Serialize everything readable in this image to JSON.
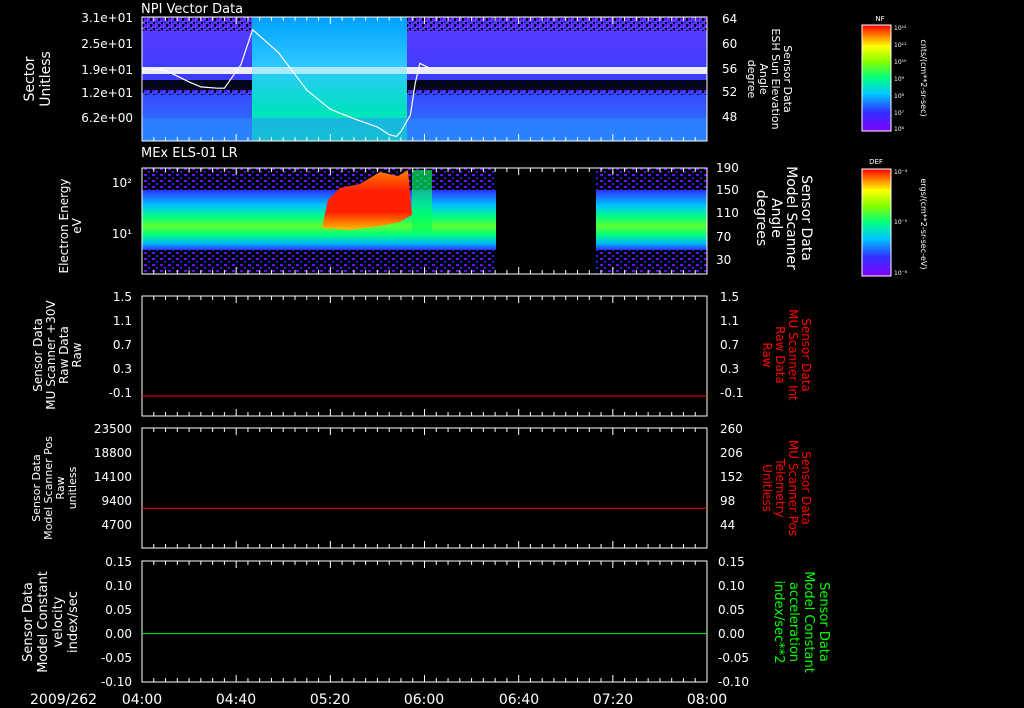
{
  "time_axis": {
    "date": "2009/262",
    "ticks": [
      "04:00",
      "04:40",
      "05:20",
      "06:00",
      "06:40",
      "07:20",
      "08:00"
    ]
  },
  "colorbars": [
    {
      "label": "NF",
      "units": "cnts/(cm**2-sr-sec)",
      "tick_labels": [
        "10¹²",
        "10¹¹",
        "10¹⁰",
        "10⁹",
        "10⁸",
        "10⁷",
        "10⁶"
      ]
    },
    {
      "label": "DEF",
      "units": "ergs/(cm**2-sr-sec-eV)",
      "tick_labels": [
        "10⁻⁴",
        "10⁻⁵",
        "10⁻⁶"
      ]
    }
  ],
  "chart_data": [
    {
      "type": "heatmap",
      "title": "NPI Vector Data",
      "ylabel": [
        "Sector",
        "Unitless"
      ],
      "y_ticks": [
        "3.1e+01",
        "2.5e+01",
        "1.9e+01",
        "1.2e+01",
        "6.2e+00"
      ],
      "right_label": [
        "Sensor Data",
        "ESH Sun Elevation",
        "Angle",
        "degree"
      ],
      "right_ticks": [
        64,
        60,
        56,
        52,
        48
      ],
      "right_range": [
        44.5,
        64
      ],
      "line_series": {
        "name": "ESH Sun Elevation Angle",
        "x": [
          "04:00",
          "04:10",
          "04:20",
          "04:25",
          "04:32",
          "04:35",
          "04:42",
          "04:47",
          "04:58",
          "05:10",
          "05:20",
          "05:30",
          "05:40",
          "05:45",
          "05:48",
          "05:50",
          "05:54",
          "05:56",
          "05:58",
          "06:02"
        ],
        "y": [
          55.8,
          55.6,
          53.8,
          53.0,
          52.8,
          52.8,
          56.5,
          62.0,
          58.4,
          52.5,
          49.5,
          48.0,
          46.7,
          45.5,
          45.2,
          46.0,
          48.6,
          53.5,
          56.7,
          56.0
        ]
      }
    },
    {
      "type": "heatmap",
      "title": "MEx ELS-01 LR",
      "ylabel": [
        "Electron Energy",
        "eV"
      ],
      "y_ticks": [
        "10²",
        "10¹"
      ],
      "right_label": [
        "Sensor Data",
        "Model Scanner",
        "Angle",
        "degrees"
      ],
      "right_ticks": [
        190,
        150,
        110,
        70,
        30
      ],
      "data_gaps": [
        [
          "06:37",
          "07:20"
        ]
      ]
    },
    {
      "type": "line",
      "ylabel": [
        "Sensor Data",
        "MU Scanner +30V",
        "Raw Data",
        "Raw"
      ],
      "y_ticks": [
        "1.5",
        "1.1",
        "0.7",
        "0.3",
        "-0.1"
      ],
      "ylim": [
        -0.3,
        1.5
      ],
      "right_label": [
        "Sensor Data",
        "MU Scanner Int",
        "Raw Data",
        "Raw"
      ],
      "right_ticks": [
        "1.5",
        "1.1",
        "0.7",
        "0.3",
        "-0.1"
      ],
      "series": [
        {
          "x": [
            "04:00",
            "08:00"
          ],
          "values": [
            0.0,
            0.0
          ],
          "color": "#ff0000"
        }
      ]
    },
    {
      "type": "line",
      "ylabel": [
        "Sensor Data",
        "Model Scanner Pos",
        "Raw",
        "unitless"
      ],
      "y_ticks": [
        "23500",
        "18800",
        "14100",
        "9400",
        "4700"
      ],
      "ylim": [
        0,
        23500
      ],
      "right_label": [
        "Sensor Data",
        "MU Scanner Pos",
        "Telemetry",
        "Unitless"
      ],
      "right_ticks": [
        "260",
        "206",
        "152",
        "98",
        "44"
      ],
      "series": [
        {
          "x": [
            "04:00",
            "08:00"
          ],
          "values": [
            7800,
            7800
          ],
          "color": "#ff0000"
        }
      ]
    },
    {
      "type": "line",
      "ylabel": [
        "Sensor Data",
        "Model Constant",
        "velocity",
        "index/sec"
      ],
      "y_ticks": [
        "0.15",
        "0.10",
        "0.05",
        "0.00",
        "-0.05",
        "-0.10"
      ],
      "ylim": [
        -0.1,
        0.15
      ],
      "right_label": [
        "Sensor Data",
        "Model Constant",
        "acceleration",
        "index/sec**2"
      ],
      "right_ticks": [
        "0.15",
        "0.10",
        "0.05",
        "0.00",
        "-0.05",
        "-0.10"
      ],
      "series": [
        {
          "x": [
            "04:00",
            "08:00"
          ],
          "values": [
            0.0,
            0.0
          ],
          "color": "#00ff00"
        }
      ]
    }
  ],
  "colors": {
    "axis": "#ffffff",
    "red_label": "#ff0000",
    "green_label": "#00ff00"
  }
}
